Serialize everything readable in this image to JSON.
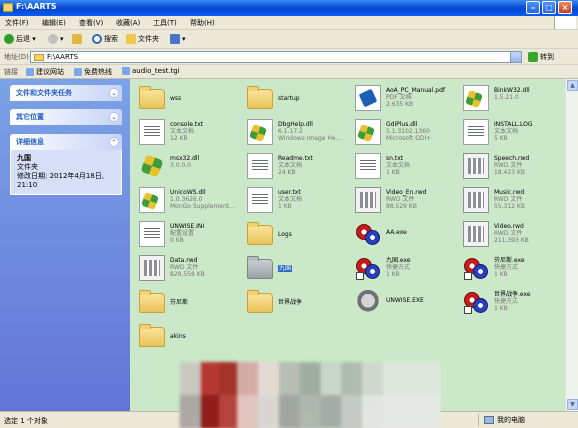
{
  "window": {
    "title": "F:\\AARTS"
  },
  "menu": [
    "文件(F)",
    "编辑(E)",
    "查看(V)",
    "收藏(A)",
    "工具(T)",
    "帮助(H)"
  ],
  "toolbar": {
    "back": "后退",
    "search": "搜索",
    "folders": "文件夹"
  },
  "address": {
    "label": "地址(D)",
    "value": "F:\\AARTS",
    "go": "转到"
  },
  "links": {
    "label": "链接",
    "items": [
      "建议网站",
      "免费热线",
      "audio_test.tgi"
    ]
  },
  "sidebar": {
    "tasks_title": "文件和文件夹任务",
    "other_title": "其它位置",
    "details_title": "详细信息",
    "details_name": "九国",
    "details_type": "文件夹",
    "details_modified": "修改日期: 2012年4月18日, 21:10"
  },
  "files": [
    {
      "name": "wss",
      "l2": "",
      "l3": "",
      "icon": "folder"
    },
    {
      "name": "startup",
      "l2": "",
      "l3": "",
      "icon": "folder"
    },
    {
      "name": "AoA_PC_Manual.pdf",
      "l2": "PDF 文档",
      "l3": "2,635 KB",
      "icon": "pdf"
    },
    {
      "name": "BinkW32.dll",
      "l2": "1.5.21.0",
      "l3": "",
      "icon": "dll"
    },
    {
      "name": "console.txt",
      "l2": "文本文档",
      "l3": "12 KB",
      "icon": "doc"
    },
    {
      "name": "DbgHelp.dll",
      "l2": "6.1.17.2",
      "l3": "Windows Image He...",
      "icon": "dll"
    },
    {
      "name": "GdiPlus.dll",
      "l2": "5.1.3102.1360",
      "l3": "Microsoft GDI+",
      "icon": "dll"
    },
    {
      "name": "INSTALL.LOG",
      "l2": "文本文档",
      "l3": "5 KB",
      "icon": "doc"
    },
    {
      "name": "msx32.dll",
      "l2": "3.0.0.0",
      "l3": "",
      "icon": "gear"
    },
    {
      "name": "Readme.txt",
      "l2": "文本文档",
      "l3": "24 KB",
      "icon": "doc"
    },
    {
      "name": "sn.txt",
      "l2": "文本文档",
      "l3": "1 KB",
      "icon": "doc"
    },
    {
      "name": "Speech.rwd",
      "l2": "RWD 文件",
      "l3": "18,423 KB",
      "icon": "rwd"
    },
    {
      "name": "UnicoWS.dll",
      "l2": "1.0.3626.0",
      "l3": "MonGo Supplement...",
      "icon": "dll"
    },
    {
      "name": "user.txt",
      "l2": "文本文档",
      "l3": "1 KB",
      "icon": "doc"
    },
    {
      "name": "Video_En.rwd",
      "l2": "RWD 文件",
      "l3": "88,529 KB",
      "icon": "rwd"
    },
    {
      "name": "Music.rwd",
      "l2": "RWD 文件",
      "l3": "55,312 KB",
      "icon": "rwd"
    },
    {
      "name": "UNWISE.INI",
      "l2": "配置设置",
      "l3": "0 KB",
      "icon": "doc"
    },
    {
      "name": "Logs",
      "l2": "",
      "l3": "",
      "icon": "folder"
    },
    {
      "name": "AA.exe",
      "l2": "",
      "l3": "",
      "icon": "app"
    },
    {
      "name": "Video.rwd",
      "l2": "RWD 文件",
      "l3": "211,393 KB",
      "icon": "rwd"
    },
    {
      "name": "Data.rwd",
      "l2": "RWD 文件",
      "l3": "829,558 KB",
      "icon": "rwd"
    },
    {
      "name": "九国",
      "l2": "",
      "l3": "",
      "icon": "folder-grey",
      "selected": true
    },
    {
      "name": "九国.exe",
      "l2": "快捷方式",
      "l3": "1 KB",
      "icon": "app-sc"
    },
    {
      "name": "芬尼斯.exe",
      "l2": "快捷方式",
      "l3": "1 KB",
      "icon": "app-sc"
    },
    {
      "name": "芬尼斯",
      "l2": "",
      "l3": "",
      "icon": "folder"
    },
    {
      "name": "世界战争",
      "l2": "",
      "l3": "",
      "icon": "folder"
    },
    {
      "name": "UNWISE.EXE",
      "l2": "",
      "l3": "",
      "icon": "setup"
    },
    {
      "name": "世界战争.exe",
      "l2": "快捷方式",
      "l3": "1 KB",
      "icon": "app-sc"
    },
    {
      "name": "akins",
      "l2": "",
      "l3": "",
      "icon": "folder"
    }
  ],
  "status": {
    "left": "选定 1 个对象",
    "zone": "我的电脑"
  }
}
